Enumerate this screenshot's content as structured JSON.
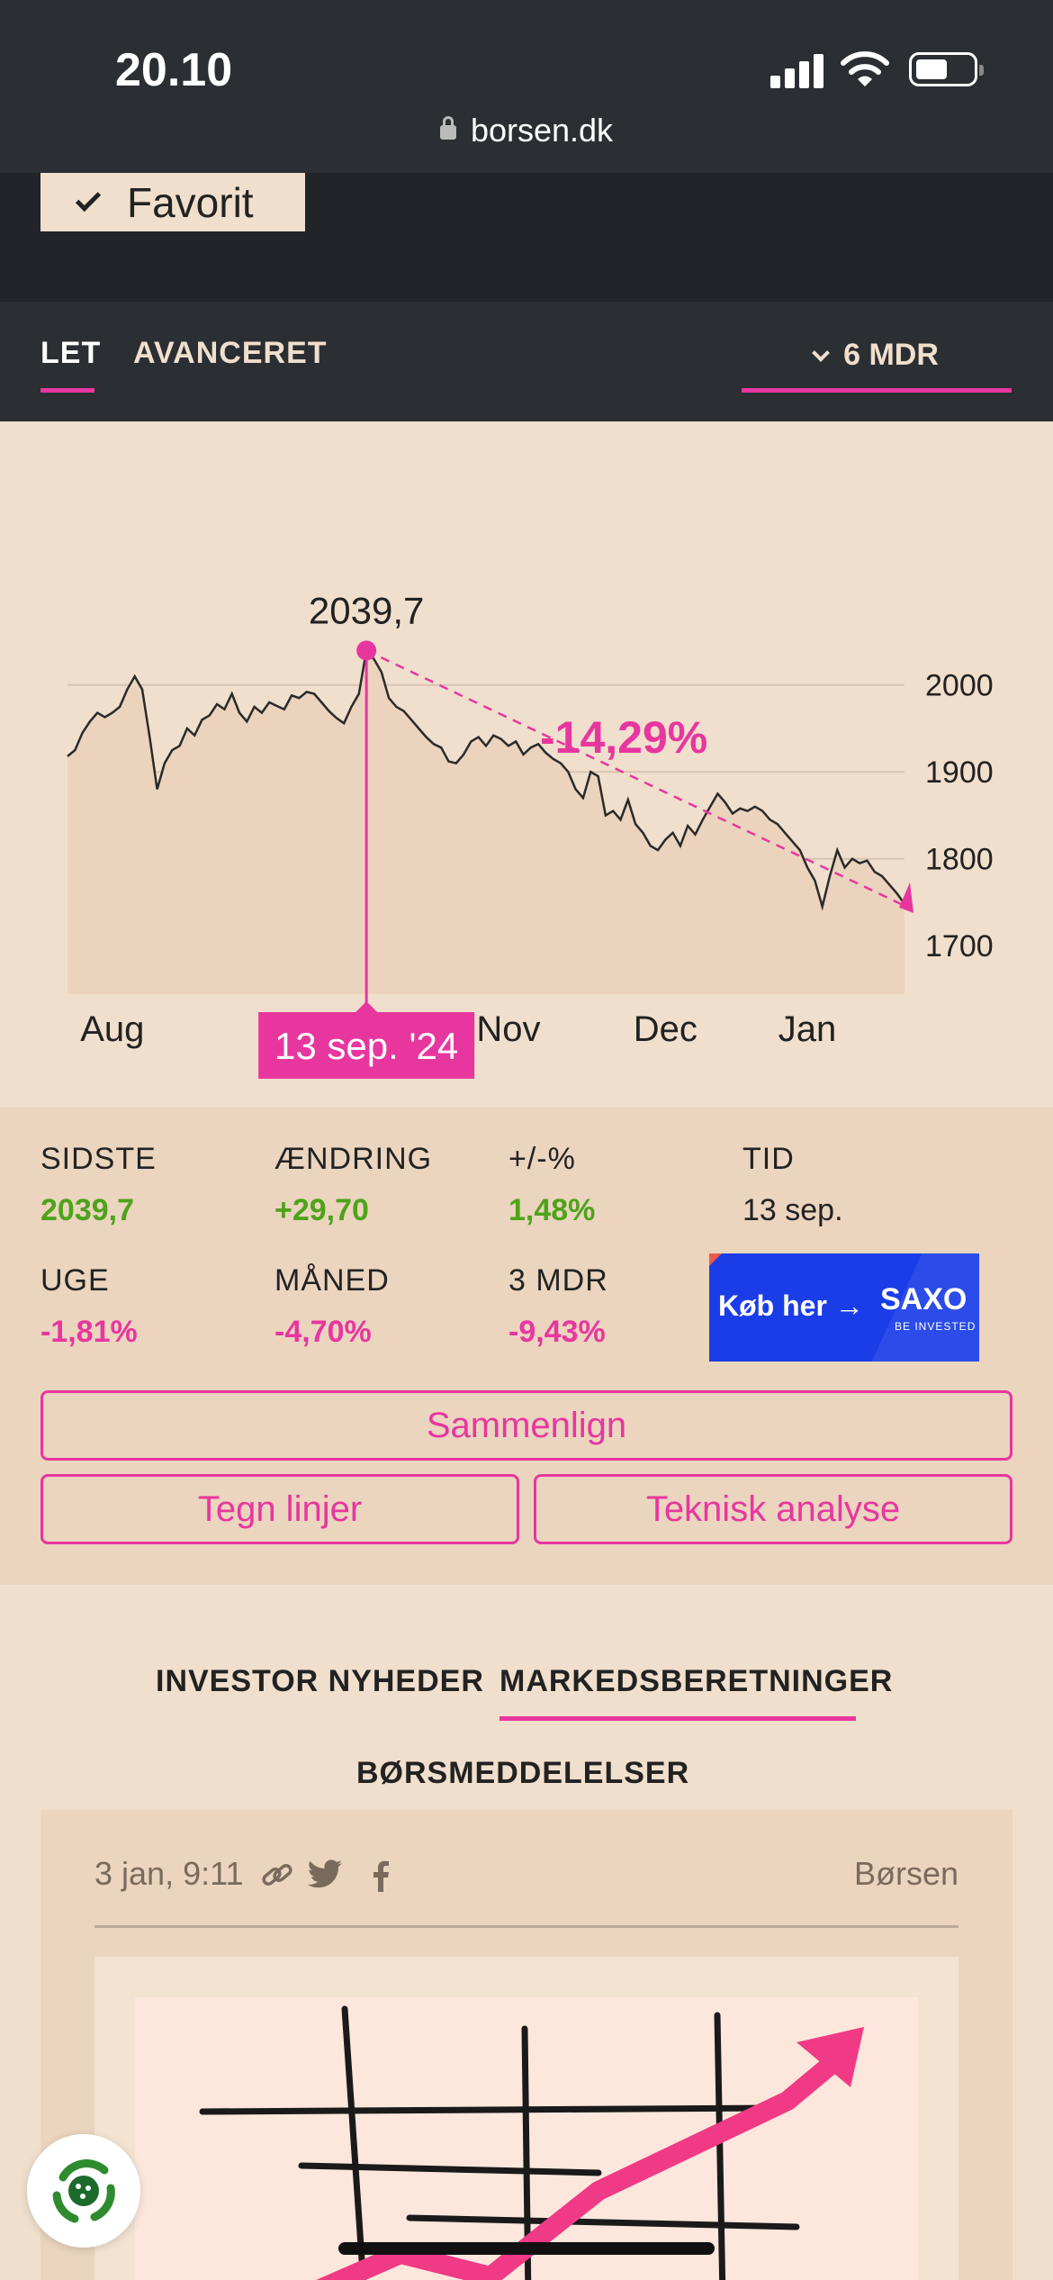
{
  "status_bar": {
    "time": "20.10",
    "url": "borsen.dk"
  },
  "header": {
    "favorit_label": "Favorit"
  },
  "tabs": {
    "let": "LET",
    "avanceret": "AVANCERET",
    "period": "6 MDR"
  },
  "chart_data": {
    "type": "area",
    "x_labels": [
      "Aug",
      "Nov",
      "Dec",
      "Jan"
    ],
    "y_ticks": [
      2000,
      1900,
      1800,
      1700
    ],
    "ylim": [
      1665,
      2000
    ],
    "grid": true,
    "peak": {
      "date": "13 sep. '24",
      "value": 2039.7,
      "label": "2039,7"
    },
    "change_label": "-14,29%",
    "series": [
      {
        "values": [
          1918,
          1925,
          1945,
          1958,
          1968,
          1963,
          1968,
          1975,
          1995,
          2010,
          1995,
          1940,
          1880,
          1910,
          1925,
          1930,
          1950,
          1942,
          1960,
          1965,
          1978,
          1972,
          1990,
          1968,
          1958,
          1975,
          1968,
          1980,
          1976,
          1972,
          1988,
          1985,
          1992,
          1990,
          1980,
          1970,
          1962,
          1956,
          1975,
          1990,
          2039.7,
          2030,
          2015,
          1985,
          1975,
          1970,
          1960,
          1950,
          1940,
          1932,
          1928,
          1912,
          1910,
          1920,
          1935,
          1940,
          1930,
          1942,
          1938,
          1930,
          1935,
          1920,
          1928,
          1932,
          1922,
          1915,
          1910,
          1900,
          1880,
          1870,
          1900,
          1895,
          1850,
          1855,
          1845,
          1868,
          1840,
          1830,
          1815,
          1810,
          1822,
          1830,
          1815,
          1838,
          1828,
          1845,
          1860,
          1875,
          1865,
          1852,
          1858,
          1855,
          1860,
          1855,
          1845,
          1840,
          1830,
          1820,
          1810,
          1790,
          1775,
          1745,
          1780,
          1810,
          1790,
          1800,
          1795,
          1798,
          1785,
          1780,
          1770,
          1760,
          1748
        ]
      }
    ]
  },
  "stats": {
    "sidste": {
      "label": "SIDSTE",
      "value": "2039,7"
    },
    "aendring": {
      "label": "ÆNDRING",
      "value": "+29,70"
    },
    "pct": {
      "label": "+/-%",
      "value": "1,48%"
    },
    "tid": {
      "label": "TID",
      "value": "13 sep."
    },
    "uge": {
      "label": "UGE",
      "value": "-1,81%"
    },
    "maaned": {
      "label": "MÅNED",
      "value": "-4,70%"
    },
    "mdr3": {
      "label": "3 MDR",
      "value": "-9,43%"
    }
  },
  "ad": {
    "cta": "Køb her →",
    "brand": "SAXO",
    "tagline": "BE INVESTED"
  },
  "buttons": {
    "sammenlign": "Sammenlign",
    "tegn_linjer": "Tegn linjer",
    "teknisk_analyse": "Teknisk analyse"
  },
  "news": {
    "tab_investor": "INVESTOR NYHEDER",
    "tab_markeds": "MARKEDSBERETNINGER",
    "tab_bors": "BØRSMEDDELELSER",
    "card": {
      "timestamp": "3 jan, 9:11",
      "source": "Børsen"
    }
  },
  "colors": {
    "accent": "#e8369f",
    "positive": "#4ea31a",
    "dark_bg": "#2b2e33",
    "page_bg": "#f0dfcc"
  }
}
